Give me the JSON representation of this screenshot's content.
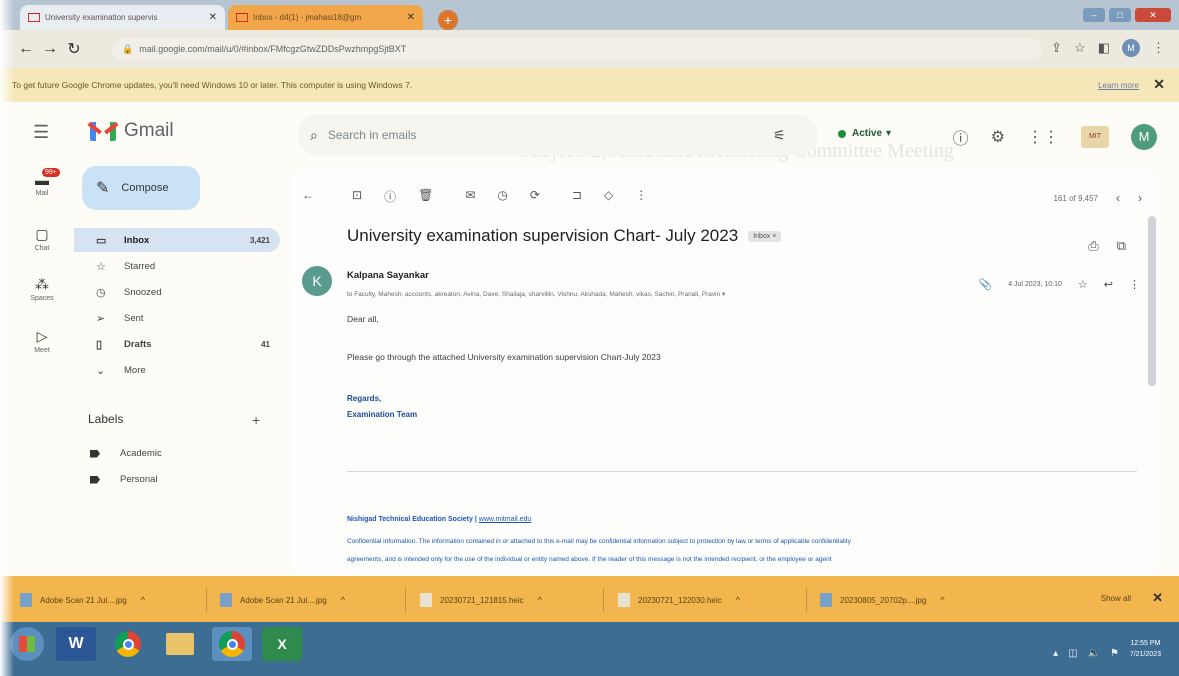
{
  "browser": {
    "tabs": [
      {
        "label": "University examination supervis"
      },
      {
        "label": "Inbox - d4(1) - jmahasi18@gm"
      }
    ],
    "new_tab_label": "+",
    "url": "mail.google.com/mail/u/0/#inbox/FMfcgzGtwZDDsPwzhmpgSjtBXT",
    "infobar_text": "To get future Google Chrome updates, you'll need Windows 10 or later. This computer is using Windows 7.",
    "infobar_link": "Learn more",
    "infobar_close": "✕",
    "profile_initial": "M"
  },
  "gmail": {
    "app_name": "Gmail",
    "search_placeholder": "Search in emails",
    "status": "Active",
    "account_initial": "M",
    "org_logo_text": "MIT",
    "rail": [
      {
        "label": "Mail",
        "icon": "mail-icon",
        "badge": "99+"
      },
      {
        "label": "Chat",
        "icon": "chat-icon"
      },
      {
        "label": "Spaces",
        "icon": "spaces-icon"
      },
      {
        "label": "Meet",
        "icon": "meet-icon"
      }
    ],
    "compose_label": "Compose",
    "nav": [
      {
        "label": "Inbox",
        "count": "3,421",
        "icon": "inbox-icon"
      },
      {
        "label": "Starred",
        "count": "",
        "icon": "star-icon"
      },
      {
        "label": "Snoozed",
        "count": "",
        "icon": "clock-icon"
      },
      {
        "label": "Sent",
        "count": "",
        "icon": "send-icon"
      },
      {
        "label": "Drafts",
        "count": "41",
        "icon": "draft-icon"
      },
      {
        "label": "More",
        "count": "",
        "icon": "chevron-down-icon"
      }
    ],
    "labels_heading": "Labels",
    "labels": [
      "Academic",
      "Personal"
    ]
  },
  "message": {
    "pager_text": "161 of 9,457",
    "subject": "University examination supervision Chart- July 2023",
    "inbox_chip": "Inbox ×",
    "sender_initial": "K",
    "sender": "Kalpana Sayankar",
    "recipients": "to Faculty, Mahesh, accounts, akreaton, Avina, Dave, Shailaja, sharvillin, Vishnu, Akshada, Mahesh, vikas, Sachin, Pranali, Pravin ▾",
    "date": "4 Jul 2023, 10:10",
    "greeting": "Dear all,",
    "body": "Please go through the attached University examination supervision Chart-July 2023",
    "regards": "Regards,",
    "team": "Examination Team",
    "org_name": "Nishigad Technical Education Society",
    "org_url": "www.mitmail.edu",
    "confidential_1": "Confidential information. The information contained in or attached to this e-mail may be confidential information subject to protection by law or terms of applicable confidentiality",
    "confidential_2": "agreements, and is intended only for the use of the individual or entity named above. If the reader of this message is not the intended recipient, or the employee or agent"
  },
  "downloads": {
    "items": [
      "Adobe Scan 21 Jul....jpg",
      "Adobe Scan 21 Jul....jpg",
      "20230721_121815.heic",
      "20230721_122030.heic",
      "20230805_20702p....jpg"
    ],
    "show_all": "Show all",
    "close": "✕"
  },
  "taskbar": {
    "word_label": "W",
    "excel_label": "X",
    "time": "12:55 PM",
    "date": "7/21/2023"
  },
  "background_doc_text": "Subject: 2) Academic Monitoring Committee Meeting"
}
